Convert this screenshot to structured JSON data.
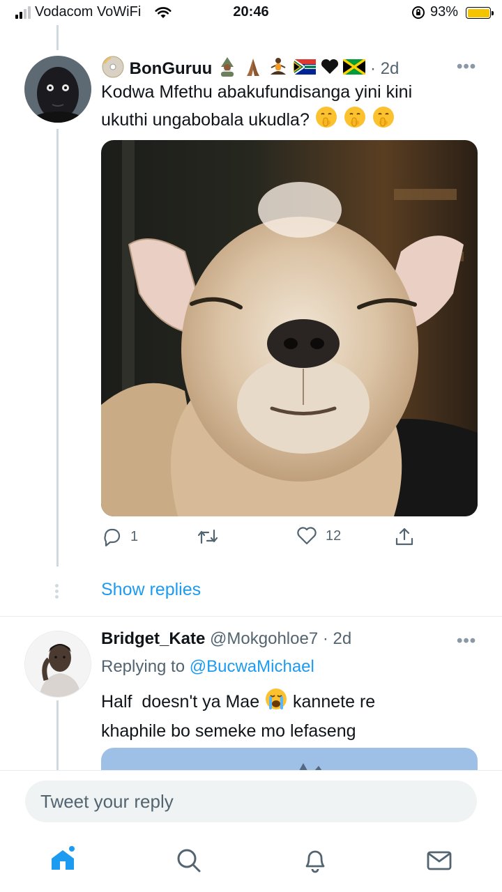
{
  "status": {
    "carrier": "Vodacom VoWiFi",
    "time": "20:46",
    "battery": "93%",
    "battery_level": 0.93
  },
  "tweet1": {
    "name": "BonGuruu",
    "time": "2d",
    "text_line1": "Kodwa Mfethu abakufundisanga yini kini",
    "text_line2": "ukuthi ungabobala ukudla?",
    "more": "•••",
    "reply_count": "1",
    "like_count": "12"
  },
  "show_replies": "Show replies",
  "tweet2": {
    "name": "Bridget_Kate",
    "handle": "@Mokgohloe7",
    "time": "2d",
    "replying_prefix": "Replying to",
    "replying_to": "@BucwaMichael",
    "text_line1_a": "Half  doesn't ya Mae",
    "text_line1_b": "kannete re",
    "text_line2": "khaphile bo semeke mo lefaseng",
    "more": "•••"
  },
  "reply_placeholder": "Tweet your reply",
  "colors": {
    "accent": "#1d9bf0",
    "muted": "#536471",
    "battery": "#f5c400"
  },
  "icons": [
    "signal-icon",
    "wifi-icon",
    "rotation-lock-icon",
    "battery-icon",
    "reply-icon",
    "retweet-icon",
    "like-icon",
    "share-icon",
    "home-icon",
    "search-icon",
    "notifications-icon",
    "messages-icon"
  ]
}
